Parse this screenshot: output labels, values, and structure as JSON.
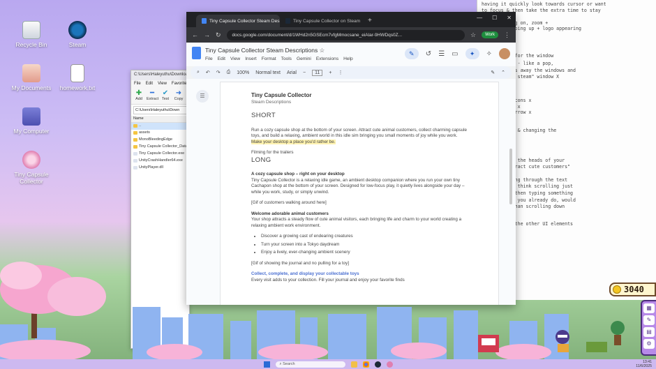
{
  "desktop": {
    "icons": [
      {
        "label": "Recycle Bin",
        "icon": "recycle-bin-icon"
      },
      {
        "label": "Steam",
        "icon": "steam-icon"
      },
      {
        "label": "My Documents",
        "icon": "folder-icon"
      },
      {
        "label": "homework.txt",
        "icon": "text-file-icon"
      },
      {
        "label": "My Computer",
        "icon": "computer-icon"
      },
      {
        "label": "Tiny Capsule Collector",
        "icon": "capsule-game-icon"
      }
    ]
  },
  "notepad": {
    "lines": [
      "having it quickly look towards cursor or want",
      "to focus & then take the extra time to stay",
      "to linger",
      "so much going on, zoom +",
      "electric popping up + logo appearing",
      "time.",
      "uilt effect for the window",
      "disappearing - like a pop,",
      "r that clicks away the windows and",
      "\"wishlist on steam\" window X",
      "s !",
      "e font for icons x",
      "the top left x",
      "ittle link arrow  x",
      "icon x",
      "king desktop & changing the",
      "ible in game",
      "like showing the heads of your",
      "it says \"attract cute customers\"",
      "like scrolling through the text",
      "show open, I think scrolling just",
      "rection and then typing something",
      "ghting, like you already do, would",
      "ble better than scrolling down",
      "the size of the other UI elements"
    ]
  },
  "explorer": {
    "title": "C:\\Users\\Haleyuthu\\Downloads",
    "menu": [
      "File",
      "Edit",
      "View",
      "Favorites"
    ],
    "toolbar": [
      "Add",
      "Extract",
      "Test",
      "Copy"
    ],
    "address": "C:\\Users\\Haleyuthu\\Down",
    "column": "Name",
    "files": [
      {
        "name": "..",
        "type": "folder",
        "selected": false
      },
      {
        "name": "assets",
        "type": "folder",
        "selected": false
      },
      {
        "name": "MonoBleedingEdge",
        "type": "folder",
        "selected": false
      },
      {
        "name": "Tiny Capsule Collector_Data",
        "type": "folder",
        "selected": false
      },
      {
        "name": "Tiny Capsule Collector.exe",
        "type": "doc",
        "selected": false
      },
      {
        "name": "UnityCrashHandler64.exe",
        "type": "doc",
        "selected": false
      },
      {
        "name": "UnityPlayer.dll",
        "type": "doc",
        "selected": false
      }
    ]
  },
  "chrome": {
    "tabs": [
      {
        "title": "Tiny Capsule Collector Steam Des",
        "active": true
      },
      {
        "title": "Tiny Capsule Collector on Steam",
        "active": false
      }
    ],
    "url": "docs.google.com/document/d/1WHd2n5GSEcm7vfgMmocsane_eiAlar-9HWDqs0Z...",
    "work_label": "Work"
  },
  "docs": {
    "title": "Tiny Capsule Collector Steam Descriptions",
    "menus": [
      "File",
      "Edit",
      "View",
      "Insert",
      "Format",
      "Tools",
      "Gemini",
      "Extensions",
      "Help"
    ],
    "toolbar": {
      "zoom": "100%",
      "style": "Normal text",
      "font": "Arial",
      "size": "11"
    }
  },
  "page": {
    "title": "Tiny Capsule Collector",
    "subtitle": "Steam Descriptions",
    "short_heading": "SHORT",
    "short_text_1": "Run a cozy capsule shop at the bottom of your screen. Attract cute animal customers, collect charming capsule toys, and build a relaxing, ambient world in this idle sim bringing you small moments of joy while you work. ",
    "short_text_2": "Make your desktop a place you'd rather be.",
    "filming_note": "Filming for the trailers",
    "long_heading": "LONG",
    "p1_title": "A cozy capsule shop – right on your desktop",
    "p1_text": "Tiny Capsule Collector is a relaxing idle game, an ambient desktop companion where you run your own tiny Cachapon shop at the bottom of your screen. Designed for low-focus play, it quietly lives alongside your day – while you work, study, or simply unwind.",
    "note_1": "[Gif of customers walking around here]",
    "p2_title": "Welcome adorable animal customers",
    "p2_text": "Your shop attracts a steady flow of cute animal visitors, each bringing life and charm to your world creating a relaxing ambient work environment.",
    "bullets": [
      "Discover a growing cast of endearing creatures",
      "Turn your screen into a Tokyo daydream",
      "Enjoy a lively, ever-changing ambient scenery"
    ],
    "note_2": "[Gif of showing the journal and no pulling for a toy]",
    "p3_title": "Collect, complete, and display your collectable toys",
    "p3_text": "Every visit adds to your collection. Fill your journal and enjoy your favorite finds"
  },
  "game": {
    "coins": "3040"
  },
  "taskbar": {
    "search_placeholder": "Search",
    "time": "13:41",
    "date": "11/6/2025"
  }
}
